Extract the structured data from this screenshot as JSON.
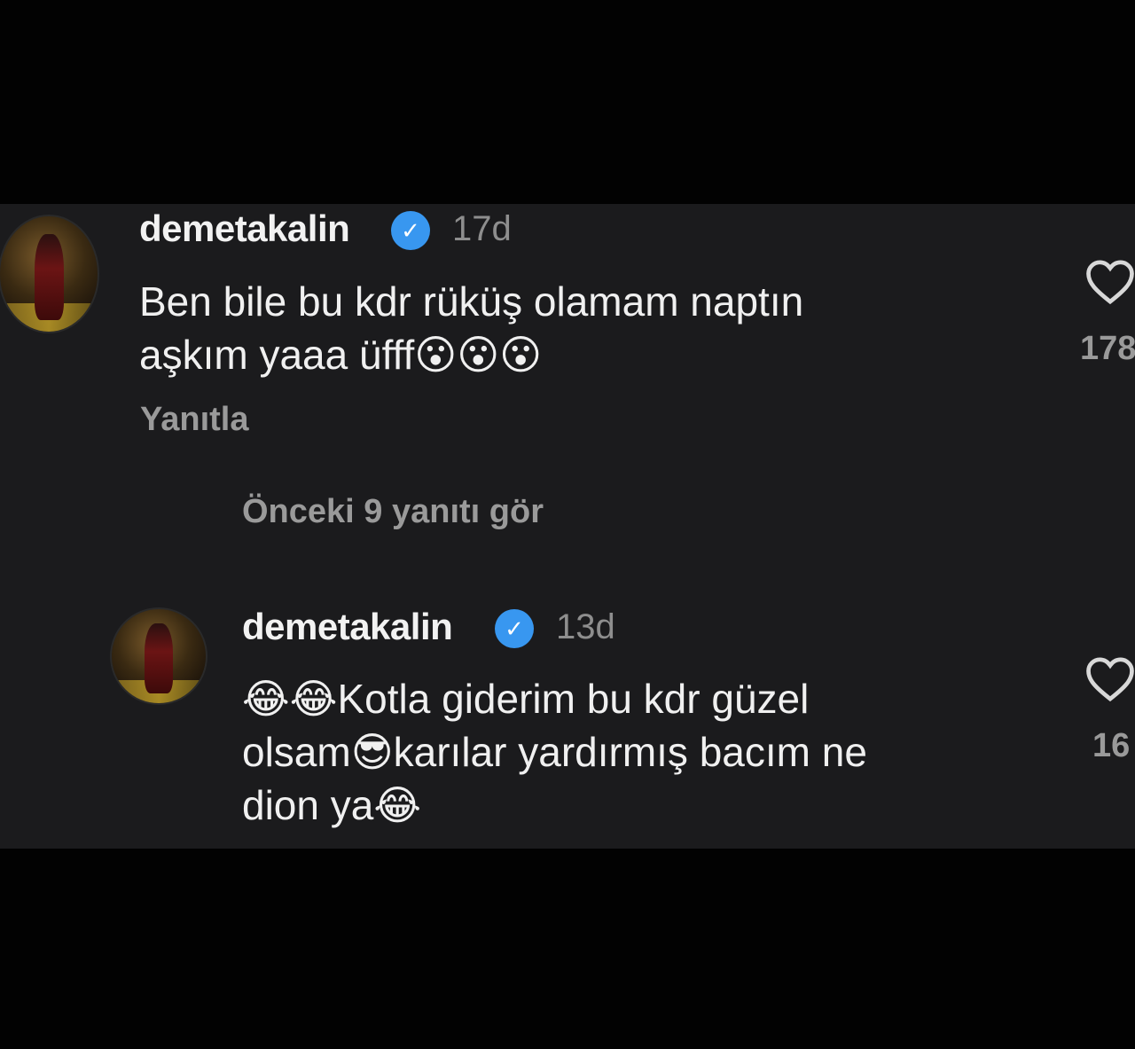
{
  "comment": {
    "username": "demetakalin",
    "time": "17d",
    "text": "Ben bile bu kdr rüküş olamam naptın\naşkım yaaa üfff😮😮😮",
    "reply_label": "Yanıtla",
    "likes": "178"
  },
  "view_replies_label": "Önceki 9 yanıtı gör",
  "reply_comment": {
    "username": "demetakalin",
    "time": "13d",
    "text": "😂😂Kotla giderim bu kdr güzel\nolsam😎karılar yardırmış bacım ne\ndion ya😂",
    "likes": "16"
  },
  "colors": {
    "verified": "#3897f0",
    "panel": "#1b1b1d",
    "muted": "#9a9a9a"
  },
  "icons": [
    "verified-badge-icon",
    "heart-icon"
  ]
}
